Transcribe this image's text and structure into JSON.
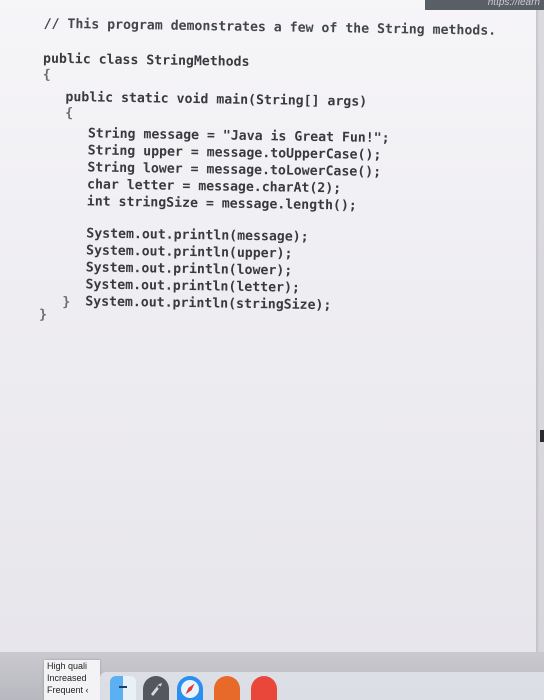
{
  "browser": {
    "url_fragment": "https://learn"
  },
  "code": {
    "lines": [
      "// This program demonstrates a few of the String methods.",
      "public class StringMethods",
      "{",
      "public static void main(String[] args)",
      "{",
      "String message = \"Java is Great Fun!\";",
      "String upper = message.toUpperCase();",
      "String lower = message.toLowerCase();",
      "char letter = message.charAt(2);",
      "int stringSize = message.length();",
      "System.out.println(message);",
      "System.out.println(upper);",
      "System.out.println(lower);",
      "System.out.println(letter);",
      "System.out.println(stringSize);",
      "}",
      "}"
    ]
  },
  "notification": {
    "lines": [
      "High quali",
      "Increased",
      "Frequent ‹"
    ]
  },
  "dock": {
    "items": [
      {
        "name": "Finder",
        "icon": "finder-icon",
        "color": "#5ab0f0"
      },
      {
        "name": "Launchpad",
        "icon": "rocket-icon",
        "color": "#55575e"
      },
      {
        "name": "Safari",
        "icon": "compass-icon",
        "color": "#2b8ff0"
      },
      {
        "name": "App",
        "icon": "app-icon",
        "color": "#e86a2a"
      },
      {
        "name": "App",
        "icon": "app-icon",
        "color": "#e9473a"
      }
    ]
  }
}
